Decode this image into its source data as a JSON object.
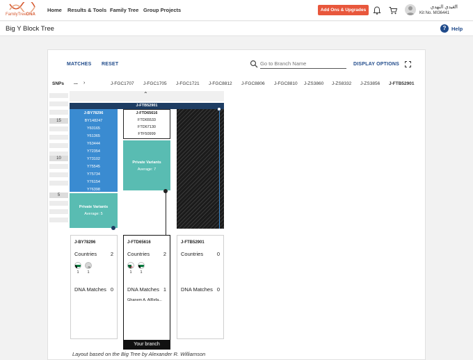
{
  "header": {
    "logo_text_light": "FamilyTree",
    "logo_text_bold": "DNA",
    "nav": [
      "Home",
      "Results & Tools",
      "Family Tree",
      "Group Projects"
    ],
    "addons_button": "Add Ons & Upgrades",
    "user_name": "العيدي النهدي",
    "user_more": "...",
    "kit_number": "Kit No. MI36441",
    "accent_color": "#e8573c"
  },
  "subheader": {
    "title": "Big Y Block Tree",
    "help": "Help"
  },
  "controls": {
    "matches": "MATCHES",
    "reset": "RESET",
    "goto_placeholder": "Go to Branch Name",
    "display_options": "DISPLAY OPTIONS"
  },
  "breadcrumb": {
    "label": "SNPs",
    "ellipsis": "...",
    "chevron": "›",
    "items": [
      "J-FGC1707",
      "J-FGC1705",
      "J-FGC1721",
      "J-FGC8812",
      "J-FGC8806",
      "J-FGC8810",
      "J-ZS3860",
      "J-ZS8332",
      "J-ZS3856",
      "J-FTB52901"
    ]
  },
  "tree": {
    "collapse_chevron": "⌃",
    "scale_labels": [
      "15",
      "10",
      "5"
    ],
    "root_branch": "J-FTB52901",
    "blue_block": {
      "head": "J-BY78296",
      "snps": [
        "BY148247",
        "Y60165",
        "Y61365",
        "Y63444",
        "Y72354",
        "Y73102",
        "Y75545",
        "Y75734",
        "Y76154",
        "Y76398"
      ]
    },
    "blue_private": {
      "title": "Private Variants",
      "average": "Average: 5"
    },
    "mid_block": {
      "head": "J-FTD65616",
      "snps": [
        "FTD65533",
        "FTD67130",
        "FTF50999"
      ]
    },
    "mid_private": {
      "title": "Private Variants",
      "average": "Average: 7"
    },
    "colors": {
      "root": "#1e3d63",
      "snp_block": "#3a8bd1",
      "private": "#59bcb2"
    }
  },
  "cards": [
    {
      "title": "J-BY78296",
      "countries_label": "Countries",
      "countries_value": "2",
      "flags": [
        {
          "icon": "kuwait-flag",
          "count": "1"
        },
        {
          "icon": "unknown-flag",
          "count": "1"
        }
      ],
      "matches_label": "DNA Matches",
      "matches_value": "0"
    },
    {
      "title": "J-FTD65616",
      "countries_label": "Countries",
      "countries_value": "2",
      "flags": [
        {
          "icon": "algeria-flag",
          "count": "1"
        },
        {
          "icon": "kuwait-flag",
          "count": "1"
        }
      ],
      "matches_label": "DNA Matches",
      "matches_value": "1",
      "match_name": "Ghanem A. AlRefa...",
      "branch_label": "Your branch"
    },
    {
      "title": "J-FTB52901",
      "countries_label": "Countries",
      "countries_value": "0",
      "matches_label": "DNA Matches",
      "matches_value": "0"
    }
  ],
  "footnote": "Layout based on the Big Tree by Alexander R. Williamson"
}
